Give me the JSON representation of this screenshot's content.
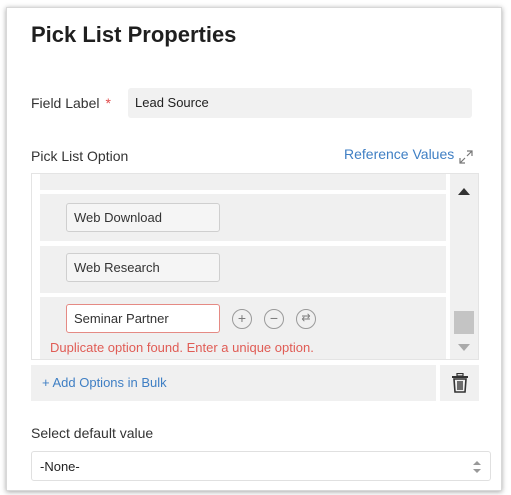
{
  "dialog": {
    "title": "Pick List Properties"
  },
  "field_label": {
    "label": "Field Label",
    "required_mark": "*",
    "value": "Lead Source"
  },
  "pick_list": {
    "title": "Pick List Option",
    "reference_link": "Reference Values",
    "expand_icon": "expand-icon",
    "options": [
      {
        "label": "Web Download"
      },
      {
        "label": "Web Research"
      },
      {
        "label": "Seminar Partner",
        "error": "Duplicate option found. Enter a unique option."
      }
    ],
    "row_actions": {
      "add_icon": "plus-circle-icon",
      "remove_icon": "minus-circle-icon",
      "reorder_icon": "swap-circle-icon"
    },
    "add_bulk": "+ Add Options in Bulk",
    "delete_icon": "trash-icon"
  },
  "default_value": {
    "label": "Select default value",
    "selected": "-None-"
  },
  "colors": {
    "link": "#3f7fc4",
    "error": "#e05c55",
    "required": "#e04b4b",
    "panel_bg": "#f0f0f0"
  }
}
